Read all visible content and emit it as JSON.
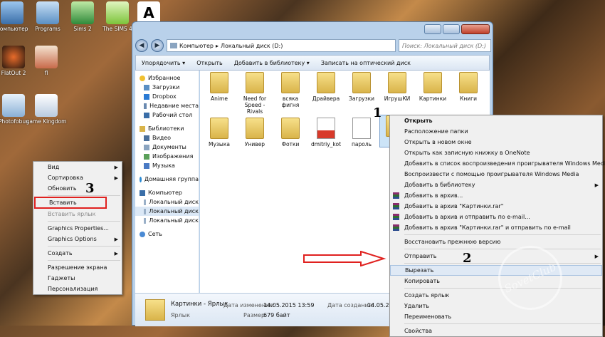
{
  "desktop_icons": [
    {
      "label": "Компьютер"
    },
    {
      "label": "Programs"
    },
    {
      "label": "Sims 2"
    },
    {
      "label": "The SIMS 4"
    },
    {
      "label": "A"
    },
    {
      "label": "FlatOut 2"
    },
    {
      "label": "fl"
    },
    {
      "label": "Photofobus"
    },
    {
      "label": "game Kingdom"
    }
  ],
  "explorer": {
    "breadcrumb": [
      "Компьютер",
      "Локальный диск (D:)"
    ],
    "search_placeholder": "Поиск: Локальный диск (D:)",
    "toolbar": [
      "Упорядочить ▾",
      "Открыть",
      "Добавить в библиотеку ▾",
      "Записать на оптический диск"
    ],
    "sidebar": {
      "favorites": {
        "label": "Избранное",
        "items": [
          "Загрузки",
          "Dropbox",
          "Недавние места",
          "Рабочий стол"
        ]
      },
      "libraries": {
        "label": "Библиотеки",
        "items": [
          "Видео",
          "Документы",
          "Изображения",
          "Музыка"
        ]
      },
      "homegroup": "Домашняя группа",
      "computer": {
        "label": "Компьютер",
        "items": [
          "Локальный диск",
          "Локальный диск",
          "Локальный диск"
        ]
      },
      "network": "Сеть"
    },
    "files_row1": [
      "Anime",
      "Need for Speed - Rivals",
      "всяка фигня",
      "Драйвера",
      "Загрузки",
      "ИгрушКИ",
      "Картинки",
      "Книги"
    ],
    "files_row2": [
      "Музыка",
      "Универ",
      "Фотки",
      "dmitriy_kot",
      "пароль",
      "Ка"
    ],
    "status": {
      "name": "Картинки - Ярлык",
      "type": "Ярлык",
      "modified_label": "Дата изменения:",
      "modified": "14.05.2015 13:59",
      "size_label": "Размер:",
      "size": "679 байт",
      "created_label": "Дата создания:",
      "created": "14.05.2015 1"
    }
  },
  "file_context_menu": [
    {
      "label": "Открыть",
      "bold": true
    },
    {
      "label": "Расположение папки"
    },
    {
      "label": "Открыть в новом окне"
    },
    {
      "label": "Открыть как записную книжку в OneNote"
    },
    {
      "label": "Добавить в список воспроизведения проигрывателя Windows Media"
    },
    {
      "label": "Воспроизвести с помощью проигрывателя Windows Media"
    },
    {
      "label": "Добавить в библиотеку",
      "submenu": true
    },
    {
      "label": "Добавить в архив...",
      "icon": "winrar-icon"
    },
    {
      "label": "Добавить в архив \"Картинки.rar\"",
      "icon": "winrar-icon"
    },
    {
      "label": "Добавить в архив и отправить по e-mail...",
      "icon": "winrar-icon"
    },
    {
      "label": "Добавить в архив \"Картинки.rar\" и отправить по e-mail",
      "icon": "winrar-icon"
    },
    {
      "sep": true
    },
    {
      "label": "Восстановить прежнюю версию"
    },
    {
      "sep": true
    },
    {
      "label": "Отправить",
      "submenu": true
    },
    {
      "sep": true
    },
    {
      "label": "Вырезать",
      "highlight": true
    },
    {
      "label": "Копировать"
    },
    {
      "sep": true
    },
    {
      "label": "Создать ярлык"
    },
    {
      "label": "Удалить"
    },
    {
      "label": "Переименовать"
    },
    {
      "sep": true
    },
    {
      "label": "Свойства"
    }
  ],
  "desktop_context_menu": [
    {
      "label": "Вид",
      "submenu": true
    },
    {
      "label": "Сортировка",
      "submenu": true
    },
    {
      "label": "Обновить"
    },
    {
      "sep": true
    },
    {
      "label": "Вставить",
      "boxed": true
    },
    {
      "label": "Вставить ярлык",
      "disabled": true
    },
    {
      "sep": true
    },
    {
      "label": "Graphics Properties..."
    },
    {
      "label": "Graphics Options",
      "submenu": true
    },
    {
      "sep": true
    },
    {
      "label": "Создать",
      "submenu": true
    },
    {
      "sep": true
    },
    {
      "label": "Разрешение экрана"
    },
    {
      "label": "Гаджеты"
    },
    {
      "label": "Персонализация"
    }
  ],
  "step_labels": [
    "1",
    "2",
    "3"
  ],
  "watermark": "SovetClub",
  "colors": {
    "highlight_box": "#e0211f",
    "arrow": "#e0211f",
    "menu_hover": "#dfe9f5"
  }
}
